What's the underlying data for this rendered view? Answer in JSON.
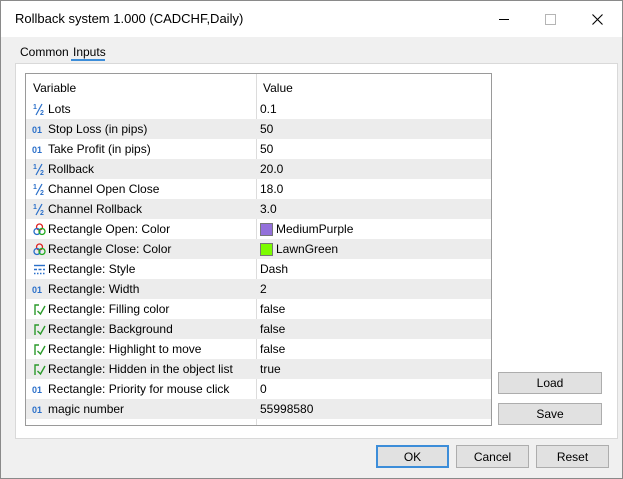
{
  "window": {
    "title": "Rollback system 1.000 (CADCHF,Daily)"
  },
  "tabs": [
    {
      "label": "Common"
    },
    {
      "label": "Inputs"
    }
  ],
  "grid": {
    "col_variable": "Variable",
    "col_value": "Value",
    "rows": [
      {
        "icon": "fraction-icon",
        "name": "Lots",
        "value": "0.1"
      },
      {
        "icon": "integer-icon",
        "name": "Stop Loss (in pips)",
        "value": "50"
      },
      {
        "icon": "integer-icon",
        "name": "Take Profit (in pips)",
        "value": "50"
      },
      {
        "icon": "fraction-icon",
        "name": "Rollback",
        "value": "20.0"
      },
      {
        "icon": "fraction-icon",
        "name": "Channel Open Close",
        "value": "18.0"
      },
      {
        "icon": "fraction-icon",
        "name": "Channel Rollback",
        "value": "3.0"
      },
      {
        "icon": "color-palette-icon",
        "name": "Rectangle Open: Color",
        "value": "MediumPurple",
        "swatch": "#9370db"
      },
      {
        "icon": "color-palette-icon",
        "name": "Rectangle Close: Color",
        "value": "LawnGreen",
        "swatch": "#7cfc00"
      },
      {
        "icon": "line-style-icon",
        "name": "Rectangle: Style",
        "value": "Dash"
      },
      {
        "icon": "integer-icon",
        "name": "Rectangle: Width",
        "value": "2"
      },
      {
        "icon": "boolean-icon",
        "name": "Rectangle: Filling  color",
        "value": "false"
      },
      {
        "icon": "boolean-icon",
        "name": "Rectangle: Background",
        "value": "false"
      },
      {
        "icon": "boolean-icon",
        "name": "Rectangle: Highlight to move",
        "value": "false"
      },
      {
        "icon": "boolean-icon",
        "name": "Rectangle: Hidden in the object list",
        "value": "true"
      },
      {
        "icon": "integer-icon",
        "name": "Rectangle: Priority for mouse click",
        "value": "0"
      },
      {
        "icon": "integer-icon",
        "name": "magic number",
        "value": "55998580"
      }
    ]
  },
  "side_buttons": {
    "load": "Load",
    "save": "Save"
  },
  "footer": {
    "ok": "OK",
    "cancel": "Cancel",
    "reset": "Reset"
  },
  "colors": {
    "accent": "#3c8dd9",
    "row_alt": "#ececec"
  }
}
